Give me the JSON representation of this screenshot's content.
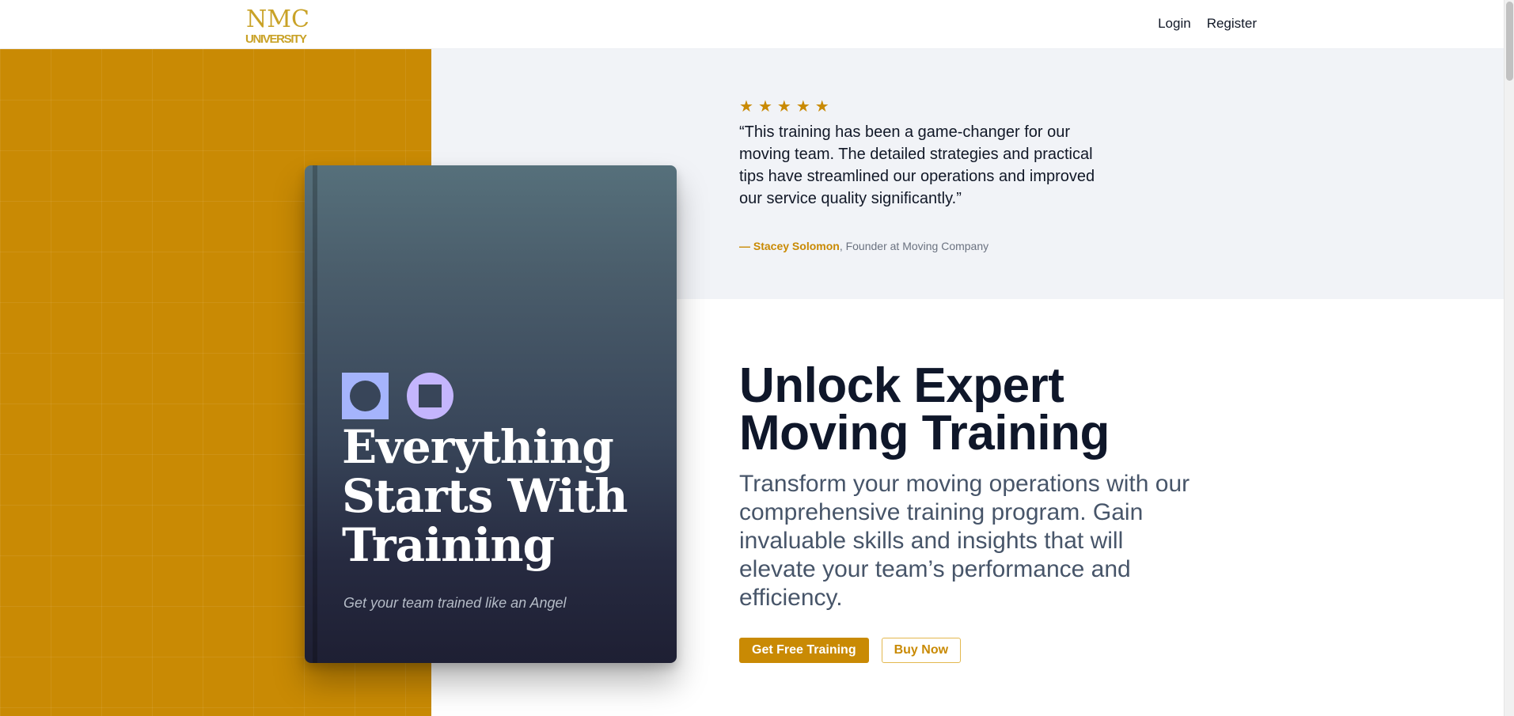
{
  "header": {
    "logo_top": "NMC",
    "logo_bottom": "UNIVERSITY",
    "nav": {
      "login": "Login",
      "register": "Register"
    }
  },
  "testimonial": {
    "rating": 5,
    "quote": "“This training has been a game-changer for our moving team. The detailed strategies and practical tips have streamlined our operations and improved our service quality significantly.”",
    "author_dash": "— ",
    "author_name": "Stacey Solomon",
    "author_role": ", Founder at Moving Company"
  },
  "book": {
    "title_line1": "Everything",
    "title_line2": "Starts With",
    "title_line3": "Training",
    "subtitle": "Get your team trained like an Angel"
  },
  "hero": {
    "title_line1": "Unlock Expert",
    "title_line2": "Moving Training",
    "description": "Transform your moving operations with our comprehensive training program. Gain invaluable skills and insights that will elevate your team’s performance and efficiency.",
    "primary_button": "Get Free Training",
    "secondary_button": "Buy Now"
  },
  "icons": {
    "star": "star-icon",
    "logo": "nmc-university-logo"
  },
  "colors": {
    "brand_gold": "#c98a04",
    "testimonial_bg": "#f1f3f7",
    "heading": "#0f172a",
    "body_text": "#475569",
    "book_top": "#56707b",
    "book_bottom": "#1e1f33",
    "accent_indigo": "#a5b4fc",
    "accent_violet": "#c4b5fd"
  }
}
